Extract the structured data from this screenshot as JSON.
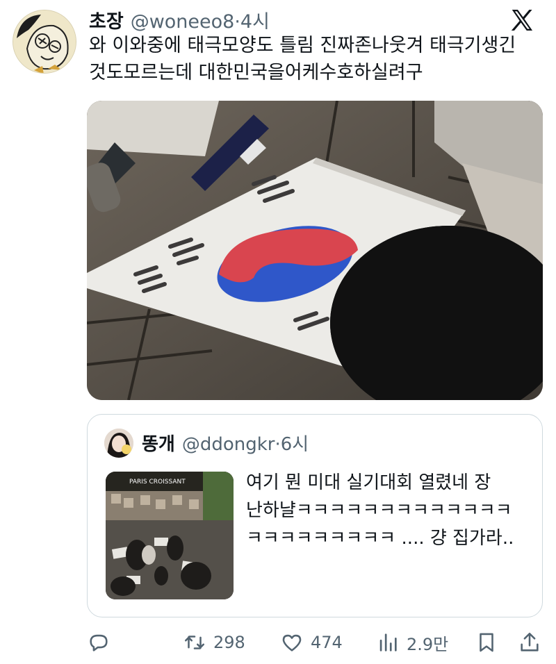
{
  "tweet": {
    "display_name": "초장",
    "handle": "@woneeo8",
    "separator": "·",
    "time": "4시",
    "text": "와 이와중에 태극모양도 틀림 진짜존나웃겨 태극기생긴\n것도모르는데 대한민국을어케수호하실려구"
  },
  "quote": {
    "display_name": "똥개",
    "handle": "@ddongkr",
    "separator": "·",
    "time": "6시",
    "text": "여기 뭔 미대 실기대회 열렸네 장\n난하냘ㅋㅋㅋㅋㅋㅋㅋㅋㅋㅋㅋㅋㅋ\nㅋㅋㅋㅋㅋㅋㅋㅋㅋ .... 걍 집가라..",
    "thumb_sign": "PARIS CROISSANT"
  },
  "actions": {
    "reply_count": "",
    "retweet_count": "298",
    "like_count": "474",
    "views_count": "2.9만"
  },
  "icons": {
    "logo": "x-logo-icon",
    "reply": "reply-icon",
    "retweet": "retweet-icon",
    "like": "heart-icon",
    "views": "views-icon",
    "bookmark": "bookmark-icon",
    "share": "share-icon"
  },
  "colors": {
    "text": "#0f1419",
    "secondary": "#536471",
    "border": "#cfd9de",
    "taegeuk_red": "#d9454f",
    "taegeuk_blue": "#2f57c9"
  }
}
